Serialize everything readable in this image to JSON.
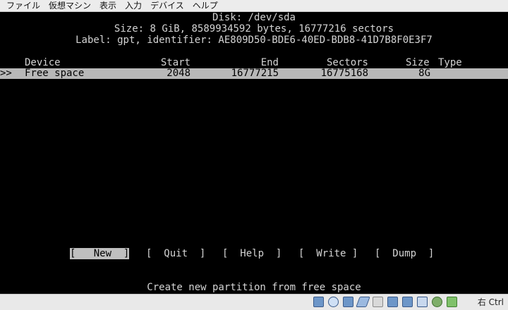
{
  "menubar": {
    "items": [
      "ファイル",
      "仮想マシン",
      "表示",
      "入力",
      "デバイス",
      "ヘルプ"
    ]
  },
  "disk": {
    "title": "Disk: /dev/sda",
    "size_line": "Size: 8 GiB, 8589934592 bytes, 16777216 sectors",
    "label_line": "Label: gpt, identifier: AE809D50-BDE6-40ED-BDB8-41D7B8F0E3F7"
  },
  "table": {
    "headers": {
      "device": "Device",
      "start": "Start",
      "end": "End",
      "sectors": "Sectors",
      "size": "Size",
      "type": "Type"
    },
    "rows": [
      {
        "marker": ">>",
        "device": "Free space",
        "start": "2048",
        "end": "16777215",
        "sectors": "16775168",
        "size": "8G",
        "type": ""
      }
    ]
  },
  "menu": {
    "buttons": [
      "[   New  ]",
      "[  Quit  ]",
      "[  Help  ]",
      "[  Write ]",
      "[  Dump  ]"
    ],
    "selected": "New"
  },
  "hint": "Create new partition from free space",
  "statusbar": {
    "icons": [
      "hard-disk-icon",
      "optical-drive-icon",
      "network-icon",
      "usb-icon",
      "shared-folder-icon",
      "display-icon",
      "screen-capture-icon",
      "video-capture-icon",
      "cpu-icon",
      "mouse-integration-icon",
      "keyboard-capture-icon"
    ],
    "host_key": "右 Ctrl"
  }
}
